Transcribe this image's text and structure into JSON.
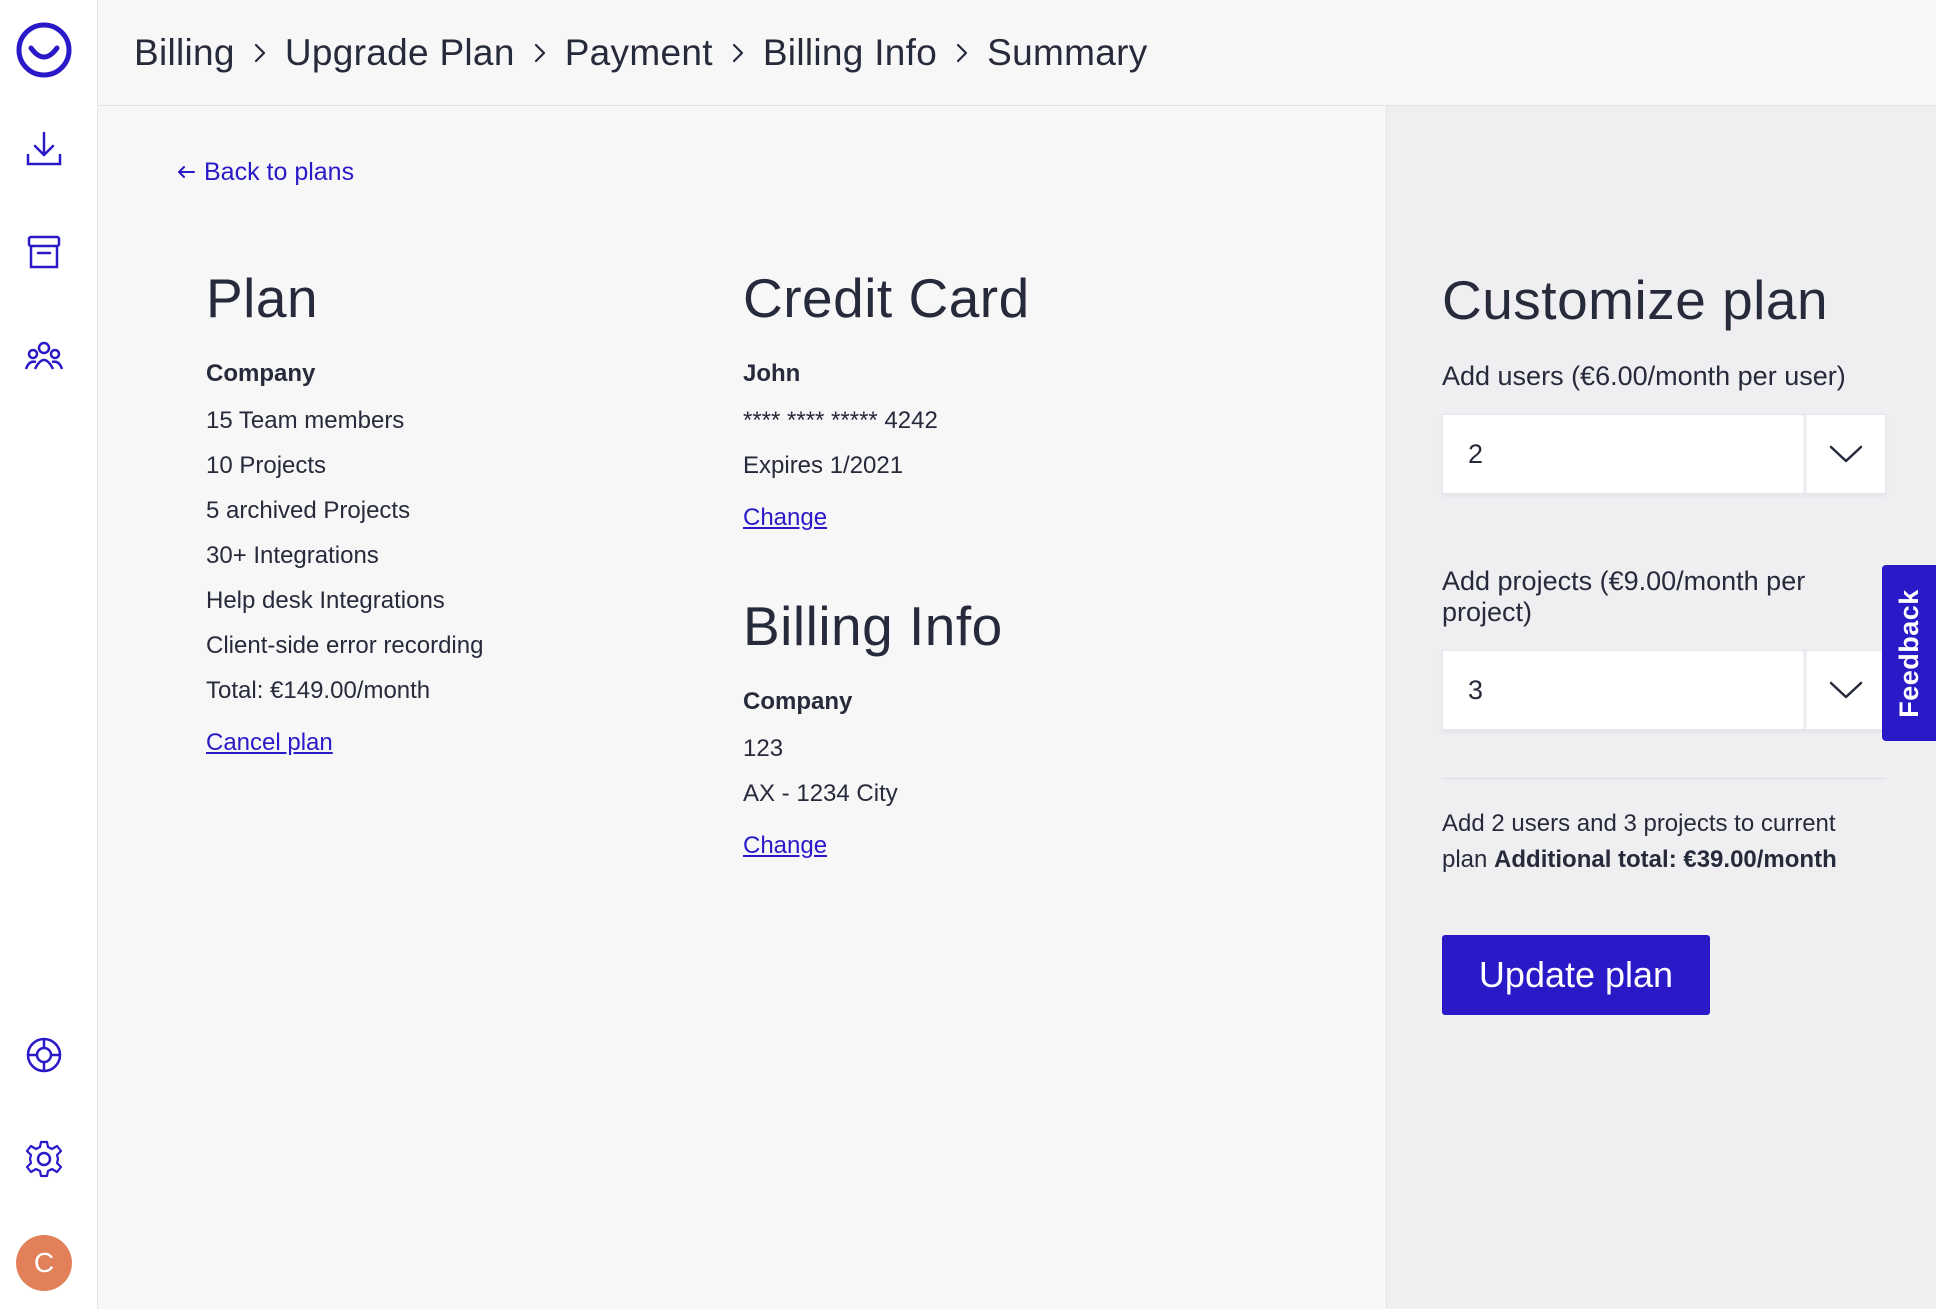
{
  "colors": {
    "accent": "#2a19c7",
    "avatar": "#e2805a"
  },
  "sidebar": {
    "logo_icon": "app-logo-icon",
    "items": [
      {
        "icon": "download-icon"
      },
      {
        "icon": "archive-box-icon"
      },
      {
        "icon": "team-icon"
      },
      {
        "icon": "lifebuoy-icon"
      },
      {
        "icon": "settings-gear-icon"
      }
    ],
    "avatar_letter": "C"
  },
  "breadcrumb": [
    "Billing",
    "Upgrade Plan",
    "Payment",
    "Billing Info",
    "Summary"
  ],
  "back_link": "Back to plans",
  "plan": {
    "title": "Plan",
    "name": "Company",
    "features": [
      "15 Team members",
      "10 Projects",
      "5 archived Projects",
      "30+ Integrations",
      "Help desk Integrations",
      "Client-side error recording",
      "Total: €149.00/month"
    ],
    "cancel_link": "Cancel plan"
  },
  "credit_card": {
    "title": "Credit Card",
    "holder": "John",
    "number": "**** **** ***** 4242",
    "expires": "Expires 1/2021",
    "change_link": "Change"
  },
  "billing_info": {
    "title": "Billing Info",
    "company": "Company",
    "line1": "123",
    "line2": "AX - 1234 City",
    "change_link": "Change"
  },
  "customize": {
    "title": "Customize plan",
    "users_label": "Add users (€6.00/month per user)",
    "users_value": "2",
    "projects_label": "Add projects (€9.00/month per project)",
    "projects_value": "3",
    "summary_text": "Add 2 users and 3 projects to current plan",
    "summary_total": "Additional total: €39.00/month",
    "update_button": "Update plan"
  },
  "feedback_tab": "Feedback"
}
